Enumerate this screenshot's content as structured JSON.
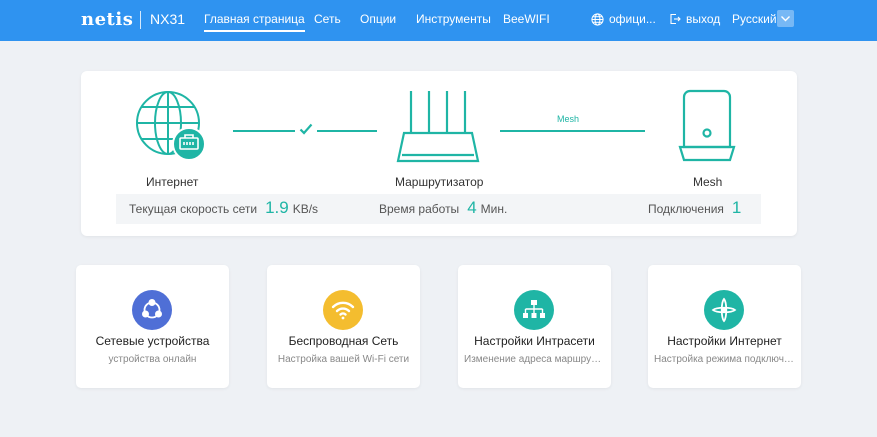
{
  "header": {
    "logo": "netis",
    "model": "NX31",
    "nav": [
      "Главная страница",
      "Сеть",
      "Опции",
      "Инструменты",
      "BeeWIFI"
    ],
    "official": "офици...",
    "logout": "выход",
    "language": "Русский"
  },
  "status": {
    "nodes": {
      "internet": "Интернет",
      "router": "Маршрутизатор",
      "mesh": "Mesh"
    },
    "mesh_link_label": "Mesh",
    "speed_label": "Текущая скорость сети",
    "speed_value": "1.9",
    "speed_unit": "KB/s",
    "uptime_label": "Время работы",
    "uptime_value": "4",
    "uptime_unit": "Мин.",
    "connections_label": "Подключения",
    "connections_value": "1"
  },
  "features": [
    {
      "title": "Сетевые устройства",
      "subtitle": "устройства онлайн",
      "icon": "devices-icon",
      "color": "#4f6fd6"
    },
    {
      "title": "Беспроводная Сеть",
      "subtitle": "Настройка вашей Wi-Fi сети",
      "icon": "wifi-icon",
      "color": "#f4bd2f"
    },
    {
      "title": "Настройки Интрасети",
      "subtitle": "Изменение адреса маршрутизатора",
      "icon": "lan-icon",
      "color": "#1fb5a5"
    },
    {
      "title": "Настройки Интернет",
      "subtitle": "Настройка режима подключения",
      "icon": "internet-settings-icon",
      "color": "#1fb5a5"
    }
  ],
  "colors": {
    "header": "#2f93f0",
    "accent": "#1fb5a5",
    "background": "#eef1f5"
  }
}
